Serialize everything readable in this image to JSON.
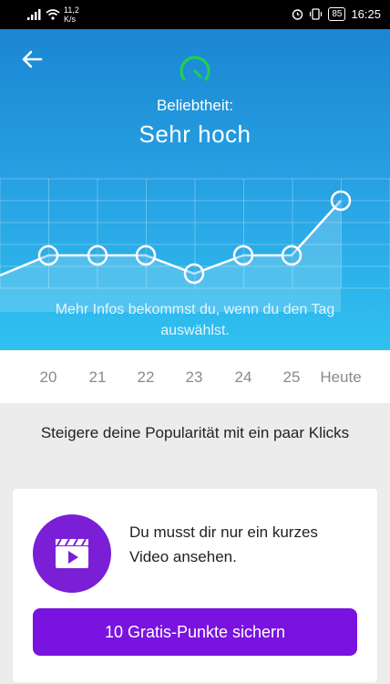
{
  "status_bar": {
    "network_speed": "11,2",
    "network_unit": "K/s",
    "battery": "85",
    "time": "16:25"
  },
  "header": {
    "label": "Beliebtheit:",
    "value": "Sehr hoch"
  },
  "chart_data": {
    "type": "line",
    "x": [
      "20",
      "21",
      "22",
      "23",
      "24",
      "25",
      "Heute"
    ],
    "values": [
      2,
      2,
      2,
      1,
      2,
      2,
      5
    ],
    "ylim": [
      0,
      6
    ],
    "grid": true,
    "title": "",
    "xlabel": "",
    "ylabel": ""
  },
  "chart_info": "Mehr Infos bekommst du, wenn du den Tag auswählst.",
  "boost": {
    "heading": "Steigere deine Popularität mit ein paar Klicks",
    "description": "Du musst dir nur ein kurzes Video ansehen.",
    "button_label": "10 Gratis-Punkte sichern",
    "icon": "video-clapper-icon"
  },
  "colors": {
    "hero_top": "#1b86d3",
    "hero_bottom": "#2fc1f0",
    "accent": "#7a12e0",
    "gauge": "#22c55e"
  }
}
